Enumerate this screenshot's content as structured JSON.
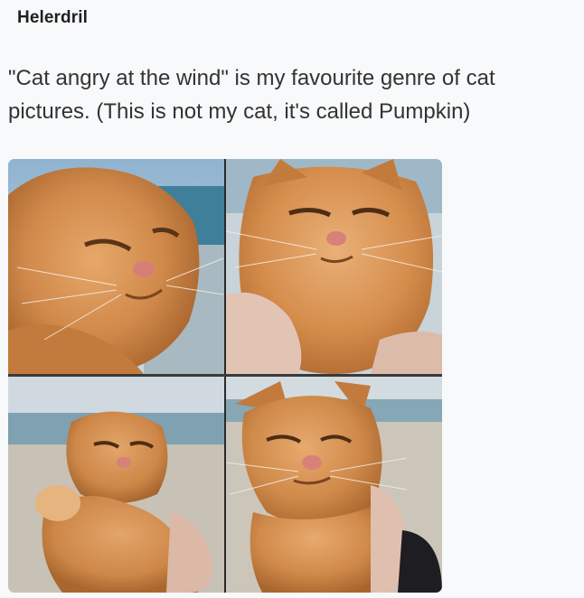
{
  "post": {
    "username": "Helerdril",
    "text": "\"Cat angry at the wind\" is my favourite genre of cat pictures. (This is not my cat, it's called Pumpkin)"
  },
  "photos": [
    {
      "subject": "orange-cat-squinting-beach"
    },
    {
      "subject": "orange-cat-held-in-hand"
    },
    {
      "subject": "orange-cat-raised-paw-beach"
    },
    {
      "subject": "orange-cat-wind-swept-ears"
    }
  ]
}
